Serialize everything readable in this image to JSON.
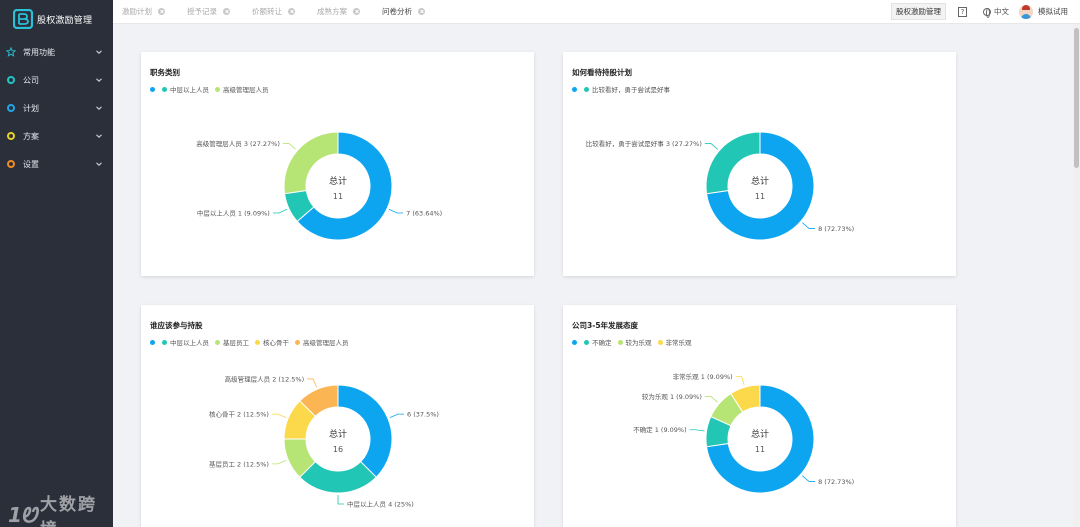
{
  "app": {
    "title": "股权激励管理"
  },
  "sidebar": {
    "items": [
      {
        "label": "常用功能",
        "icon": "star-icon",
        "color": "#29b6c8"
      },
      {
        "label": "公司",
        "icon": "ring-icon",
        "color": "#1fc6c6"
      },
      {
        "label": "计划",
        "icon": "ring-icon",
        "color": "#1fa7e8"
      },
      {
        "label": "方案",
        "icon": "ring-icon",
        "color": "#e8d21f"
      },
      {
        "label": "设置",
        "icon": "ring-icon",
        "color": "#f08a24"
      }
    ]
  },
  "tabs": [
    {
      "label": "激励计划",
      "active": false
    },
    {
      "label": "授予记录",
      "active": false
    },
    {
      "label": "价额转让",
      "active": false
    },
    {
      "label": "成熟方案",
      "active": false
    },
    {
      "label": "问卷分析",
      "active": true
    }
  ],
  "topbar": {
    "module_button": "股权激励管理",
    "help": "?",
    "language": "中文",
    "user": "模拟试用"
  },
  "watermark": {
    "mark": "1Ꮼ",
    "text": "大数跨境"
  },
  "colors": {
    "blue": "#0ea5f0",
    "green": "#b7e575",
    "teal": "#21c6b4",
    "yellow": "#fbd94b",
    "orange": "#fbb552"
  },
  "chart_data": [
    {
      "type": "pie",
      "title": "职务类别",
      "center_label": "总计",
      "total": 11,
      "slices": [
        {
          "name": "中层以上人员",
          "value": 7,
          "label": "7 (63.64%)",
          "color": "#0ea5f0",
          "legend": false
        },
        {
          "name": "中层以上人员",
          "value": 1,
          "label": "中层以上人员 1 (9.09%)",
          "color": "#21c6b4",
          "legend": true
        },
        {
          "name": "高级管理层人员",
          "value": 3,
          "label": "高级管理层人员 3 (27.27%)",
          "color": "#b7e575",
          "legend": true
        }
      ]
    },
    {
      "type": "pie",
      "title": "如何看待持股计划",
      "center_label": "总计",
      "total": 11,
      "slices": [
        {
          "name": "",
          "value": 8,
          "label": "8 (72.73%)",
          "color": "#0ea5f0",
          "legend": false
        },
        {
          "name": "比较看好，勇于尝试是好事",
          "value": 3,
          "label": "比较看好，勇于尝试是好事 3 (27.27%)",
          "color": "#21c6b4",
          "legend": true
        }
      ]
    },
    {
      "type": "pie",
      "title": "谁应该参与持股",
      "center_label": "总计",
      "total": 16,
      "slices": [
        {
          "name": "",
          "value": 6,
          "label": "6 (37.5%)",
          "color": "#0ea5f0",
          "legend": false
        },
        {
          "name": "中层以上人员",
          "value": 4,
          "label": "中层以上人员 4 (25%)",
          "color": "#21c6b4",
          "legend": true
        },
        {
          "name": "基层员工",
          "value": 2,
          "label": "基层员工 2 (12.5%)",
          "color": "#b7e575",
          "legend": true
        },
        {
          "name": "核心骨干",
          "value": 2,
          "label": "核心骨干 2 (12.5%)",
          "color": "#fbd94b",
          "legend": true
        },
        {
          "name": "高级管理层人员",
          "value": 2,
          "label": "高级管理层人员 2 (12.5%)",
          "color": "#fbb552",
          "legend": true
        }
      ]
    },
    {
      "type": "pie",
      "title": "公司3-5年发展态度",
      "center_label": "总计",
      "total": 11,
      "slices": [
        {
          "name": "",
          "value": 8,
          "label": "8 (72.73%)",
          "color": "#0ea5f0",
          "legend": false
        },
        {
          "name": "不确定",
          "value": 1,
          "label": "不确定 1 (9.09%)",
          "color": "#21c6b4",
          "legend": true
        },
        {
          "name": "较为乐观",
          "value": 1,
          "label": "较为乐观 1 (9.09%)",
          "color": "#b7e575",
          "legend": true
        },
        {
          "name": "非常乐观",
          "value": 1,
          "label": "非常乐观 1 (9.09%)",
          "color": "#fbd94b",
          "legend": true
        }
      ]
    }
  ]
}
